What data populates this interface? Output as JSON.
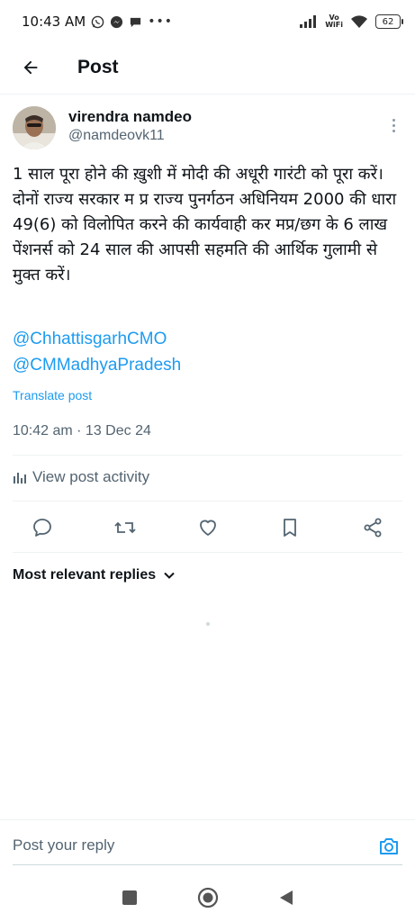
{
  "status_bar": {
    "time": "10:43 AM",
    "vowifi_top": "Vo",
    "vowifi_bottom": "WiFi",
    "battery": "62"
  },
  "header": {
    "title": "Post"
  },
  "author": {
    "name": "virendra namdeo",
    "handle": "@namdeovk11"
  },
  "post": {
    "paragraph_1": "1 साल पूरा होने की ख़ुशी में मोदी की अधूरी गारंटी को पूरा करें।",
    "paragraph_2": "दोनों राज्य सरकार म प्र राज्य पुनर्गठन अधिनियम 2000 की धारा 49(6) को विलोपित करने की कार्यवाही कर मप्र/छग के 6 लाख पेंशनर्स को 24 साल की आपसी सहमति की आर्थिक गुलामी से मुक्त करें।",
    "mentions": [
      "@ChhattisgarhCMO",
      "@CMMadhyaPradesh"
    ],
    "translate_label": "Translate post",
    "timestamp": "10:42 am · 13 Dec 24",
    "activity_label": "View post activity"
  },
  "replies": {
    "sort_label": "Most relevant replies"
  },
  "reply_bar": {
    "placeholder": "Post your reply"
  },
  "colors": {
    "accent": "#1d9bf0",
    "secondary_text": "#536471",
    "primary_text": "#0f1419"
  }
}
